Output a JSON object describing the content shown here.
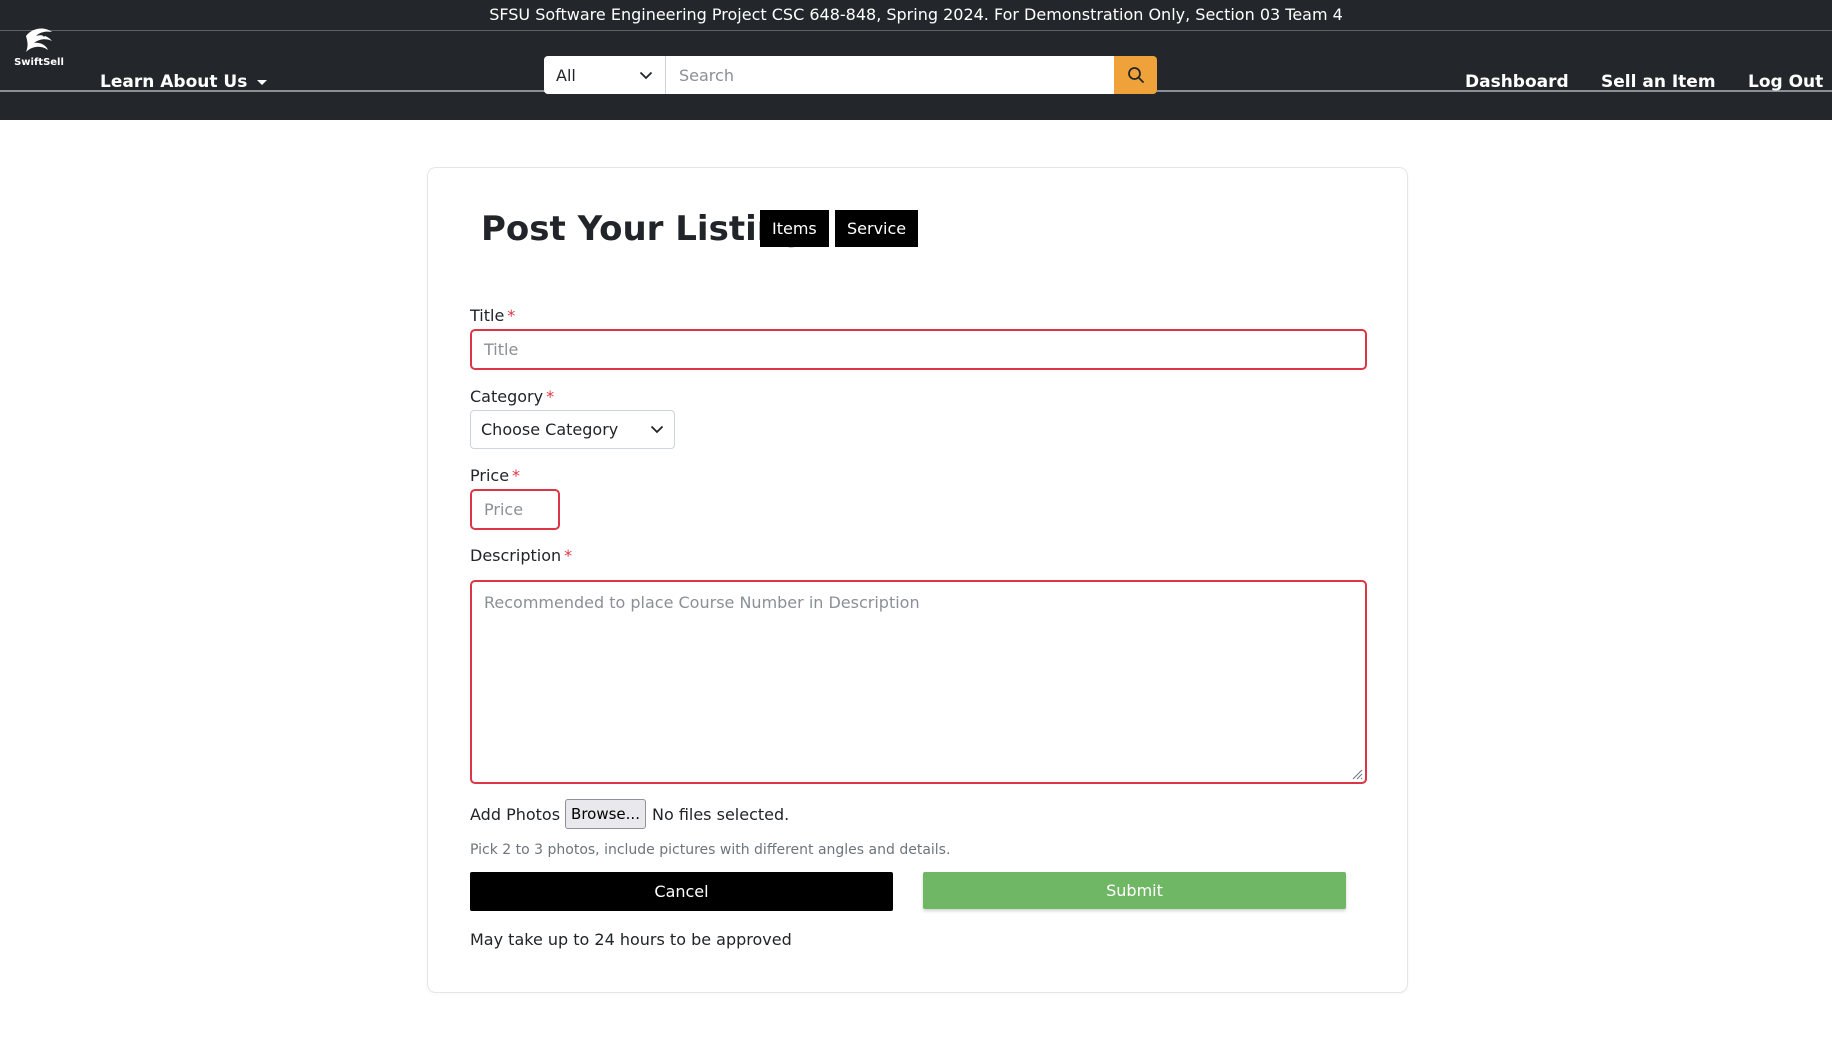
{
  "banner": {
    "text": "SFSU Software Engineering Project CSC 648-848, Spring 2024. For Demonstration Only, Section 03 Team 4"
  },
  "navbar": {
    "brand": "SwiftSell",
    "learn_label": "Learn About Us",
    "search": {
      "category_value": "All",
      "placeholder": "Search"
    },
    "links": [
      "Dashboard",
      "Sell an Item",
      "Log Out"
    ]
  },
  "form": {
    "heading": "Post Your Listing",
    "tabs": [
      "Items",
      "Service"
    ],
    "required_mark": "*",
    "title_label": "Title",
    "title_placeholder": "Title",
    "category_label": "Category",
    "category_value": "Choose Category",
    "price_label": "Price",
    "price_placeholder": "Price",
    "description_label": "Description",
    "description_placeholder": "Recommended to place Course Number in Description",
    "photos_label": "Add Photos",
    "browse_label": "Browse...",
    "file_status": "No files selected.",
    "photos_hint": "Pick 2 to 3 photos, include pictures with different angles and details.",
    "cancel_label": "Cancel",
    "submit_label": "Submit",
    "approval_note": "May take up to 24 hours to be approved"
  },
  "colors": {
    "navbar_bg": "#23272b",
    "accent_orange": "#f0a23a",
    "submit_green": "#70b765",
    "error_red": "#dc3545"
  }
}
